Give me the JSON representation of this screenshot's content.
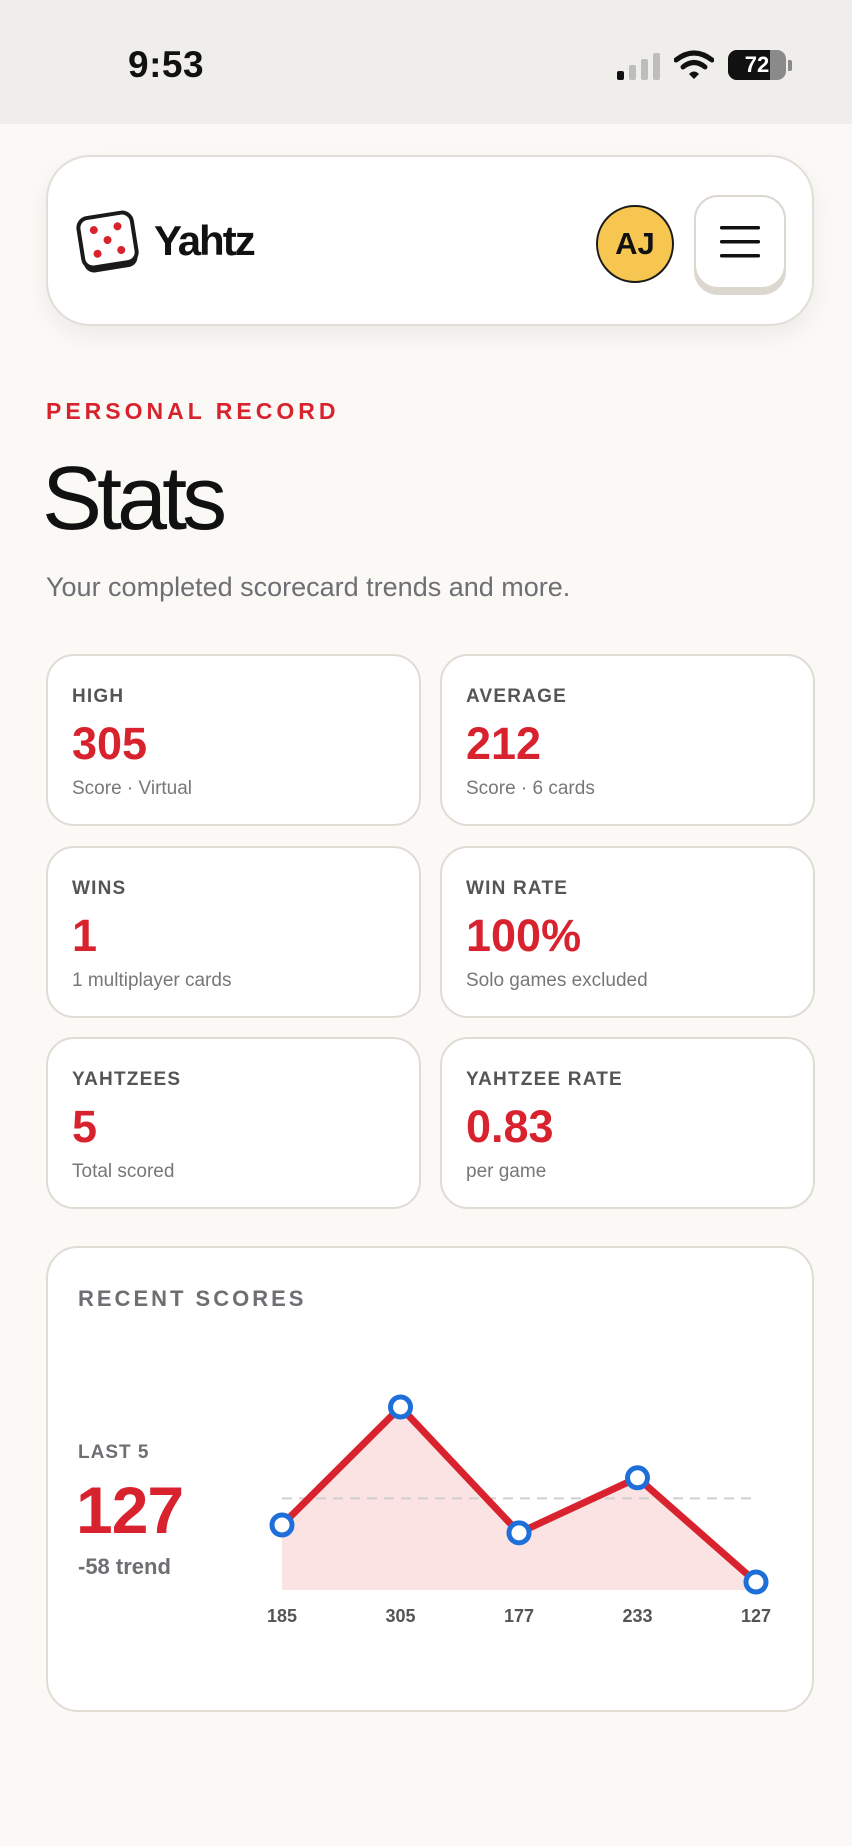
{
  "status_bar": {
    "time": "9:53",
    "battery_percent": "72",
    "battery_level": 0.72,
    "icons": [
      "cellular-signal-icon",
      "wifi-icon",
      "battery-icon"
    ]
  },
  "header": {
    "brand": "Yahtz",
    "logo_icon": "die-icon",
    "avatar_initials": "AJ",
    "menu_icon": "hamburger-menu-icon"
  },
  "page": {
    "eyebrow": "PERSONAL RECORD",
    "title": "Stats",
    "subtitle": "Your completed scorecard trends and more."
  },
  "stats": [
    {
      "label": "HIGH",
      "value": "305",
      "note": "Score · Virtual"
    },
    {
      "label": "AVERAGE",
      "value": "212",
      "note": "Score · 6 cards"
    },
    {
      "label": "WINS",
      "value": "1",
      "note": "1 multiplayer cards"
    },
    {
      "label": "WIN RATE",
      "value": "100%",
      "note": "Solo games excluded"
    },
    {
      "label": "YAHTZEES",
      "value": "5",
      "note": "Total scored"
    },
    {
      "label": "YAHTZEE RATE",
      "value": "0.83",
      "note": "per game"
    }
  ],
  "recent": {
    "heading": "RECENT SCORES",
    "last_label": "LAST 5",
    "last_value": "127",
    "trend": "-58 trend"
  },
  "colors": {
    "accent": "#d8232f",
    "point_stroke": "#1e6fd9",
    "area_fill": "#fbe3e4",
    "avatar": "#f7c651"
  },
  "chart_data": {
    "type": "line",
    "categories": [
      "185",
      "305",
      "177",
      "233",
      "127"
    ],
    "values": [
      185,
      305,
      177,
      233,
      127
    ],
    "reference_line": 212,
    "ylim": [
      127,
      305
    ],
    "grid": false
  }
}
